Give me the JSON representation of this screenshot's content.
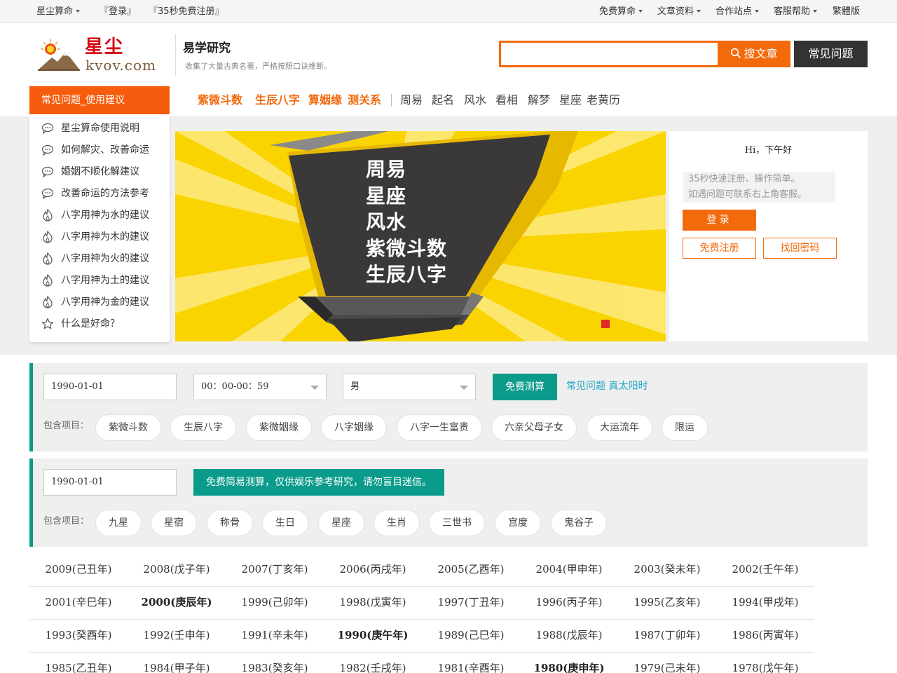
{
  "topbar": {
    "left": [
      "星尘算命",
      "『登录』",
      "『35秒免费注册』"
    ],
    "right": [
      "免费算命",
      "文章资料",
      "合作站点",
      "客服帮助",
      "繁體版"
    ]
  },
  "header": {
    "logo_cn": "星尘",
    "logo_en": "kvov.com",
    "title": "易学研究",
    "subtitle": "收集了大量古典名著，严格按照口诀推断。",
    "search_placeholder": "",
    "search_button": "搜文章",
    "faq_button": "常见问题"
  },
  "nav": {
    "menu_head": "常见问题_使用建议",
    "hot": [
      "紫微斗数",
      "生辰八字",
      "算姻缘",
      "测关系"
    ],
    "links": [
      "周易",
      "起名",
      "风水",
      "看相",
      "解梦",
      "星座",
      "老黄历"
    ]
  },
  "menu": [
    {
      "label": "星尘算命使用说明",
      "icon": "chat-icon"
    },
    {
      "label": "如何解灾、改善命运",
      "icon": "chat-icon"
    },
    {
      "label": "婚姻不顺化解建议",
      "icon": "chat-icon"
    },
    {
      "label": "改善命运的方法参考",
      "icon": "chat-icon"
    },
    {
      "label": "八字用神为水的建议",
      "icon": "flame-icon"
    },
    {
      "label": "八字用神为木的建议",
      "icon": "flame-icon"
    },
    {
      "label": "八字用神为火的建议",
      "icon": "flame-icon"
    },
    {
      "label": "八字用神为土的建议",
      "icon": "flame-icon"
    },
    {
      "label": "八字用神为金的建议",
      "icon": "flame-icon"
    },
    {
      "label": "什么是好命？",
      "icon": "star-icon"
    }
  ],
  "banner": {
    "lines": [
      "周易",
      "星座",
      "风水",
      "紫微斗数",
      "生辰八字"
    ],
    "bg_color": "#f9d400",
    "dot_color": "#e32b26"
  },
  "login": {
    "greeting": "Hi，下午好",
    "tip_line1": "35秒快速注册、操作简单。",
    "tip_line2": "如遇问题可联系右上角客服。",
    "login_button": "登录",
    "register_button": "免费注册",
    "recover_button": "找回密码"
  },
  "form1": {
    "date": "1990-01-01",
    "time": "00：00-00：59",
    "gender": "男",
    "submit": "免费测算",
    "link": "常见问题 真太阳时",
    "include_label": "包含项目：",
    "items": [
      "紫微斗数",
      "生辰八字",
      "紫微姻缘",
      "八字姻缘",
      "八字一生富贵",
      "六亲父母子女",
      "大运流年",
      "限运"
    ]
  },
  "form2": {
    "date": "1990-01-01",
    "submit": "免费简易测算，仅供娱乐参考研究，请勿盲目迷信。",
    "include_label": "包含项目：",
    "items": [
      "九星",
      "星宿",
      "称骨",
      "生日",
      "星座",
      "生肖",
      "三世书",
      "宫度",
      "鬼谷子"
    ]
  },
  "years": [
    [
      "2009(己丑年)",
      "2008(戊子年)",
      "2007(丁亥年)",
      "2006(丙戌年)",
      "2005(乙酉年)",
      "2004(甲申年)",
      "2003(癸未年)",
      "2002(壬午年)"
    ],
    [
      "2001(辛巳年)",
      "2000(庚辰年)",
      "1999(己卯年)",
      "1998(戊寅年)",
      "1997(丁丑年)",
      "1996(丙子年)",
      "1995(乙亥年)",
      "1994(甲戌年)"
    ],
    [
      "1993(癸酉年)",
      "1992(壬申年)",
      "1991(辛未年)",
      "1990(庚午年)",
      "1989(己巳年)",
      "1988(戊辰年)",
      "1987(丁卯年)",
      "1986(丙寅年)"
    ],
    [
      "1985(乙丑年)",
      "1984(甲子年)",
      "1983(癸亥年)",
      "1982(壬戌年)",
      "1981(辛酉年)",
      "1980(庚申年)",
      "1979(己未年)",
      "1978(戊午年)"
    ]
  ],
  "years_bold": [
    "2000(庚辰年)",
    "1990(庚午年)",
    "1980(庚申年)"
  ],
  "colors": {
    "accent": "#f26a0c",
    "teal": "#0b9b8b",
    "menu_head": "#f55c0d"
  }
}
